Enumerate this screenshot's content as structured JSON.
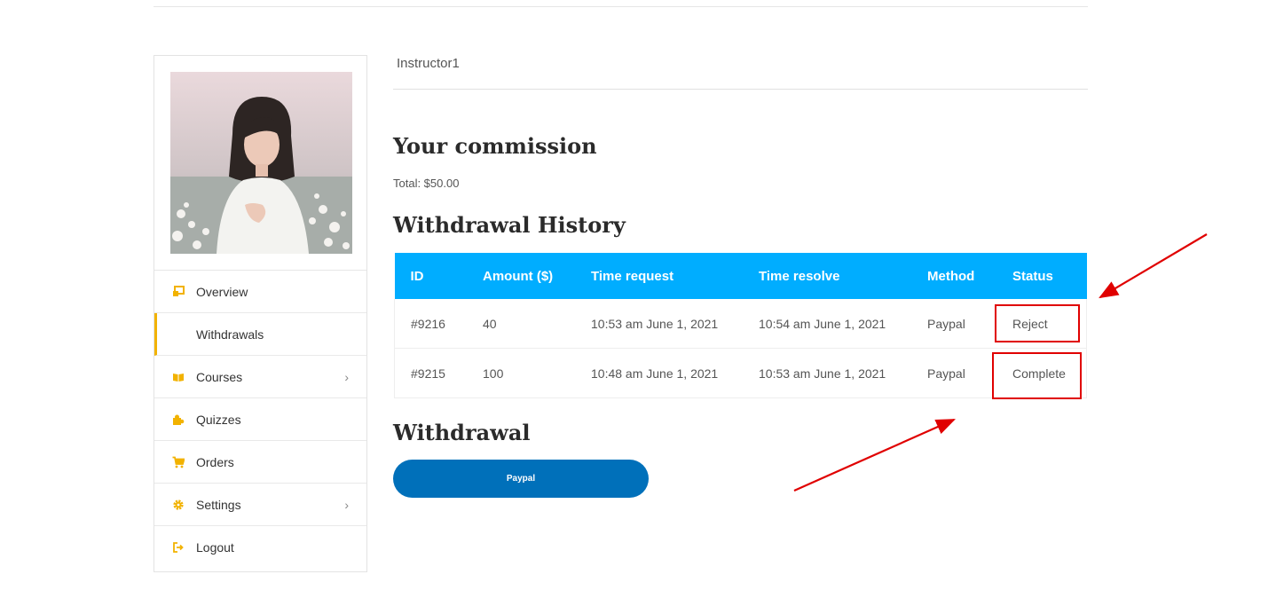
{
  "user": {
    "name": "Instructor1"
  },
  "sidebar": {
    "items": [
      {
        "label": "Overview",
        "icon": "overview-icon",
        "active": false,
        "has_submenu": false
      },
      {
        "label": "Withdrawals",
        "icon": "",
        "active": true,
        "has_submenu": false
      },
      {
        "label": "Courses",
        "icon": "book-icon",
        "active": false,
        "has_submenu": true
      },
      {
        "label": "Quizzes",
        "icon": "puzzle-icon",
        "active": false,
        "has_submenu": false
      },
      {
        "label": "Orders",
        "icon": "cart-icon",
        "active": false,
        "has_submenu": false
      },
      {
        "label": "Settings",
        "icon": "gear-icon",
        "active": false,
        "has_submenu": true
      },
      {
        "label": "Logout",
        "icon": "logout-icon",
        "active": false,
        "has_submenu": false
      }
    ],
    "chevron": "›"
  },
  "commission": {
    "title": "Your commission",
    "total": "Total: $50.00"
  },
  "history": {
    "title": "Withdrawal History",
    "columns": [
      "ID",
      "Amount ($)",
      "Time request",
      "Time resolve",
      "Method",
      "Status"
    ],
    "rows": [
      [
        "#9216",
        "40",
        "10:53 am June 1, 2021",
        "10:54 am June 1, 2021",
        "Paypal",
        "Reject"
      ],
      [
        "#9215",
        "100",
        "10:48 am June 1, 2021",
        "10:53 am June 1, 2021",
        "Paypal",
        "Complete"
      ]
    ]
  },
  "withdrawal": {
    "title": "Withdrawal",
    "button_label": "Paypal"
  },
  "colors": {
    "accent": "#00adff",
    "icon": "#f2b200",
    "paypal": "#0070ba",
    "annotation": "#e00000"
  }
}
